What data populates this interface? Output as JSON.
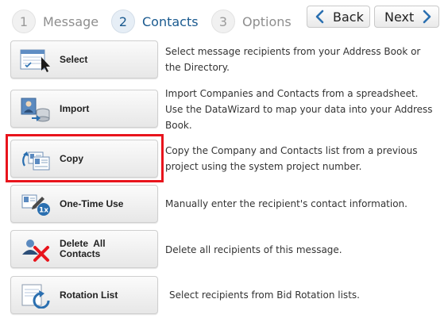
{
  "steps": [
    {
      "number": "1",
      "label": "Message"
    },
    {
      "number": "2",
      "label": "Contacts"
    },
    {
      "number": "3",
      "label": "Options"
    }
  ],
  "nav": {
    "back_label": "Back",
    "next_label": "Next"
  },
  "actions": [
    {
      "label": "Select",
      "icon": "select-list-icon",
      "description": "Select message recipients from your Address Book or the Directory."
    },
    {
      "label": "Import",
      "icon": "import-database-icon",
      "description": "Import Companies and Contacts from a spreadsheet. Use the DataWizard to map your data into your Address Book."
    },
    {
      "label": "Copy",
      "icon": "copy-contacts-icon",
      "description": "Copy the Company and Contacts list from a previous project using the system project number."
    },
    {
      "label": "One-Time Use",
      "icon": "one-time-use-icon",
      "description": "Manually enter the recipient's contact information."
    },
    {
      "label_line1": "Delete  All",
      "label_line2": "Contacts",
      "icon": "delete-contacts-icon",
      "description": "Delete all recipients of this message."
    },
    {
      "label": "Rotation List",
      "icon": "rotation-list-icon",
      "description": "Select recipients from Bid Rotation lists."
    }
  ],
  "colors": {
    "active_step": "#1a5a8f",
    "highlight": "#e8141c",
    "nav_chevron": "#2a6fb0"
  }
}
